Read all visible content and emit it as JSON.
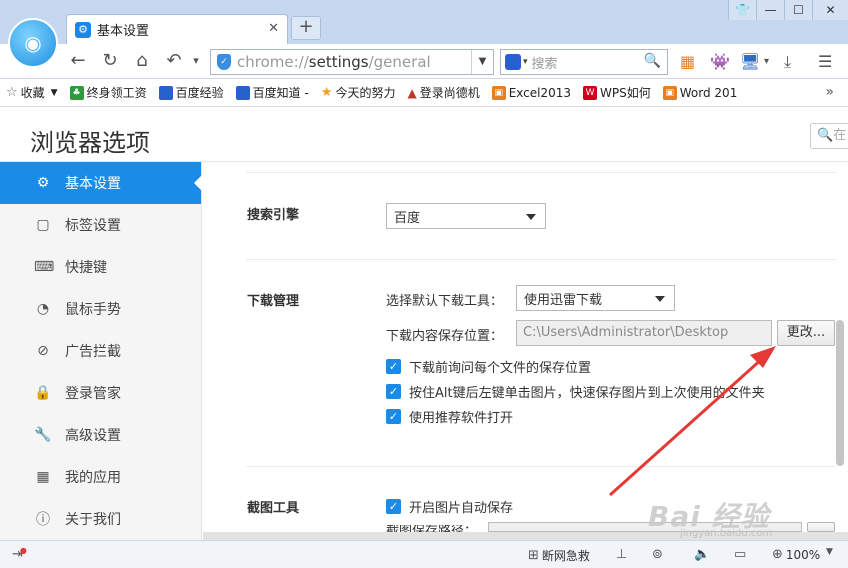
{
  "browser": {
    "tab": {
      "title": "基本设置",
      "close": "✕",
      "new_tab": "+"
    },
    "window_controls": [
      "👕",
      "—",
      "☐",
      "✕"
    ],
    "nav": {
      "back": "←",
      "reload": "↻",
      "home": "⌂",
      "undo": "↶",
      "undo_menu": "▾"
    },
    "url": {
      "scheme": "chrome://",
      "host": "settings",
      "path": "/general"
    },
    "search": {
      "placeholder": "搜索",
      "engine_icon": "paw-icon"
    },
    "bookmarks": [
      {
        "label": "收藏",
        "icon": "star-icon",
        "color": "#666666",
        "has_dropdown": true
      },
      {
        "label": "终身领工资",
        "icon": "game-icon",
        "color": "#2a9d3a"
      },
      {
        "label": "百度经验",
        "icon": "paw-icon",
        "color": "#2b5fcf"
      },
      {
        "label": "百度知道 -",
        "icon": "paw-icon",
        "color": "#2b5fcf"
      },
      {
        "label": "今天的努力",
        "icon": "star-icon",
        "color": "#f0a020"
      },
      {
        "label": "登录尚德机",
        "icon": "bird-icon",
        "color": "#c0392b"
      },
      {
        "label": "Excel2013",
        "icon": "office-icon",
        "color": "#e67e22"
      },
      {
        "label": "WPS如何",
        "icon": "wps-icon",
        "color": "#d0021b"
      },
      {
        "label": "Word 201",
        "icon": "office-icon",
        "color": "#e67e22"
      }
    ]
  },
  "page": {
    "title": "浏览器选项",
    "search_placeholder": "在"
  },
  "sidebar": {
    "items": [
      {
        "label": "基本设置",
        "icon": "gear-icon",
        "glyph": "⚙",
        "active": true
      },
      {
        "label": "标签设置",
        "icon": "tabs-icon",
        "glyph": "▢"
      },
      {
        "label": "快捷键",
        "icon": "keyboard-icon",
        "glyph": "⌨"
      },
      {
        "label": "鼠标手势",
        "icon": "mouse-icon",
        "glyph": "◔"
      },
      {
        "label": "广告拦截",
        "icon": "block-icon",
        "glyph": "⊘"
      },
      {
        "label": "登录管家",
        "icon": "lock-icon",
        "glyph": "🔒"
      },
      {
        "label": "高级设置",
        "icon": "wrench-icon",
        "glyph": "🔧"
      },
      {
        "label": "我的应用",
        "icon": "apps-icon",
        "glyph": "▦"
      },
      {
        "label": "关于我们",
        "icon": "info-icon",
        "glyph": "ⓘ"
      }
    ]
  },
  "settings": {
    "search_engine": {
      "label": "搜索引擎",
      "value": "百度"
    },
    "download": {
      "label": "下载管理",
      "tool_label": "选择默认下载工具：",
      "tool_value": "使用迅雷下载",
      "path_label": "下载内容保存位置：",
      "path_value": "C:\\Users\\Administrator\\Desktop",
      "change_button": "更改...",
      "options": [
        {
          "label": "下载前询问每个文件的保存位置",
          "checked": true
        },
        {
          "label": "按住Alt键后左键单击图片，快速保存图片到上次使用的文件夹",
          "checked": true
        },
        {
          "label": "使用推荐软件打开",
          "checked": true
        }
      ]
    },
    "screenshot": {
      "label": "截图工具",
      "auto_save": {
        "label": "开启图片自动保存",
        "checked": true
      },
      "path_label": "截图保存路径："
    }
  },
  "statusbar": {
    "network_label": "断网急救",
    "zoom": "100%"
  },
  "watermark": {
    "brand": "Bai 经验",
    "site": "jingyan.baidu.com"
  },
  "colors": {
    "accent": "#1a8be6",
    "annotation_arrow": "#e53935"
  }
}
